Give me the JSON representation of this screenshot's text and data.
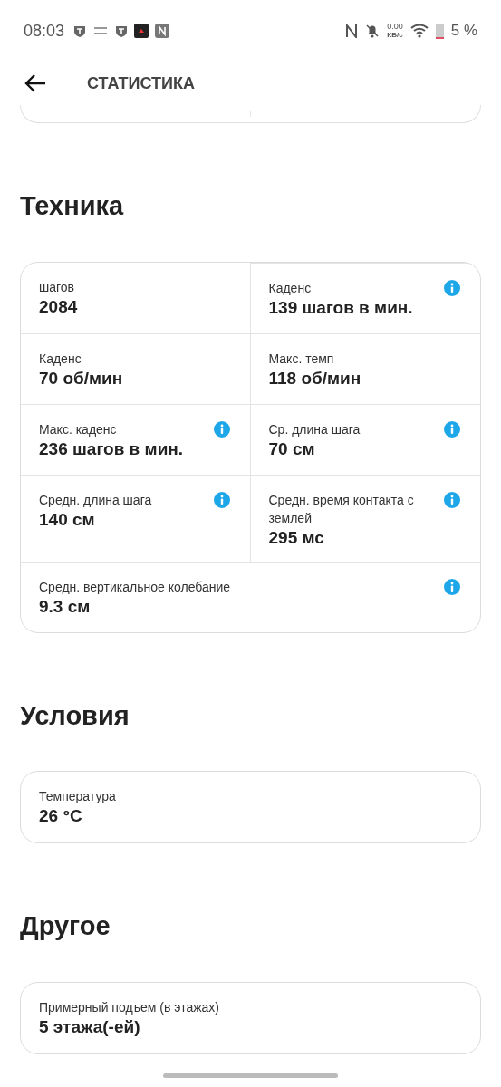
{
  "status_bar": {
    "time": "08:03",
    "net_speed": "0.00",
    "net_unit": "КБ/с",
    "battery": "5 %"
  },
  "header": {
    "title": "СТАТИСТИКА"
  },
  "sections": [
    {
      "title": "Техника",
      "cells": [
        {
          "kind": "half",
          "label": "шагов",
          "value": "2084",
          "info": false
        },
        {
          "kind": "half",
          "label": "Каденс",
          "value": "139 шагов в мин.",
          "info": true
        },
        {
          "kind": "half",
          "label": "Каденс",
          "value": "70 об/мин",
          "info": false
        },
        {
          "kind": "half",
          "label": "Макс. темп",
          "value": "118 об/мин",
          "info": false
        },
        {
          "kind": "half",
          "label": "Макс. каденс",
          "value": "236 шагов в мин.",
          "info": true
        },
        {
          "kind": "half",
          "label": "Ср. длина шага",
          "value": "70 см",
          "info": true
        },
        {
          "kind": "half",
          "label": "Средн. длина шага",
          "value": "140 см",
          "info": true
        },
        {
          "kind": "half",
          "label": "Средн. время контакта с землей",
          "value": "295 мс",
          "info": true
        },
        {
          "kind": "wide",
          "label": "Средн. вертикальное колебание",
          "value": "9.3 см",
          "info": true
        }
      ]
    },
    {
      "title": "Условия",
      "cells": [
        {
          "kind": "wide",
          "label": "Температура",
          "value": "26 °C",
          "info": false
        }
      ]
    },
    {
      "title": "Другое",
      "cells": [
        {
          "kind": "wide",
          "label": "Примерный подъем (в этажах)",
          "value": "5 этажа(-ей)",
          "info": false
        }
      ]
    }
  ]
}
